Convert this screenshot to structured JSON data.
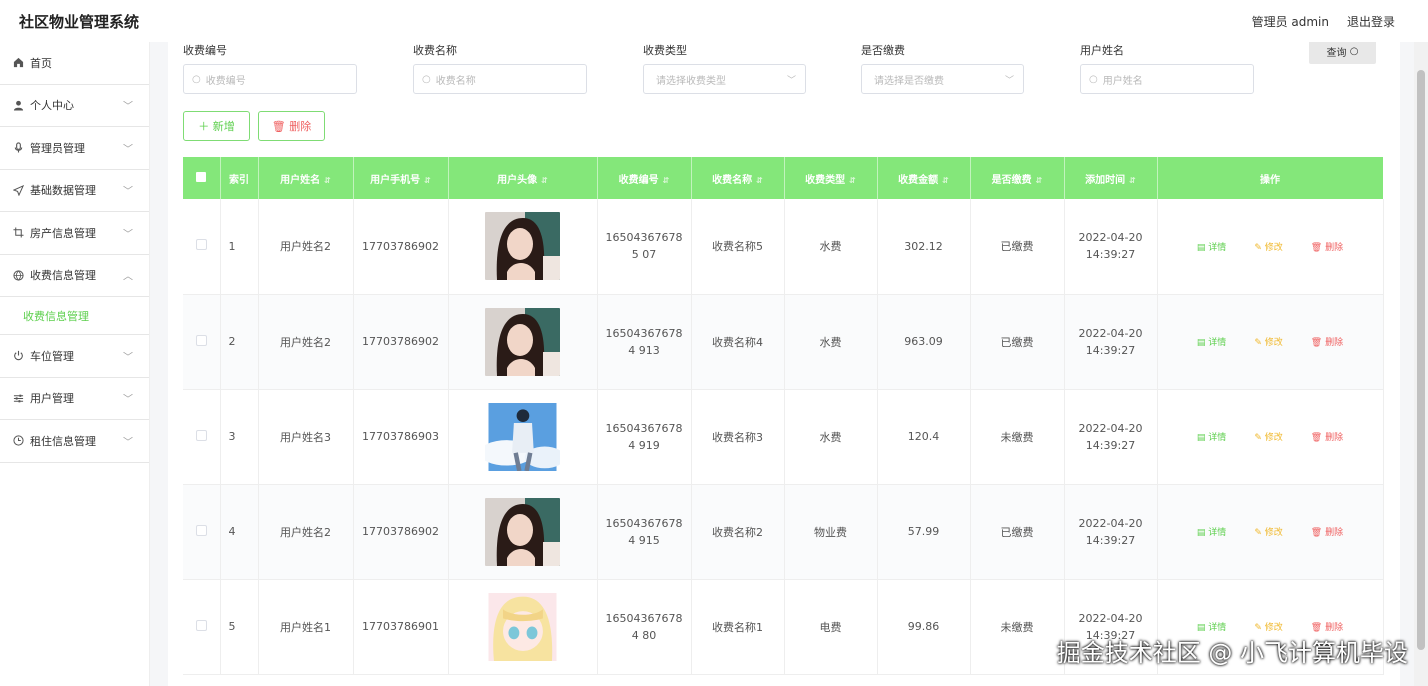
{
  "header": {
    "title": "社区物业管理系统",
    "user": "管理员 admin",
    "logout": "退出登录"
  },
  "sidebar": {
    "items": [
      {
        "label": "首页",
        "icon": "home-icon"
      },
      {
        "label": "个人中心",
        "icon": "user-icon"
      },
      {
        "label": "管理员管理",
        "icon": "mic-icon"
      },
      {
        "label": "基础数据管理",
        "icon": "send-icon"
      },
      {
        "label": "房产信息管理",
        "icon": "crop-icon"
      },
      {
        "label": "收费信息管理",
        "icon": "globe-icon"
      },
      {
        "label": "车位管理",
        "icon": "power-icon"
      },
      {
        "label": "用户管理",
        "icon": "sliders-icon"
      },
      {
        "label": "租住信息管理",
        "icon": "clock-icon"
      }
    ],
    "sub_item": "收费信息管理"
  },
  "search": {
    "fee_no": {
      "label": "收费编号",
      "placeholder": "收费编号"
    },
    "fee_name": {
      "label": "收费名称",
      "placeholder": "收费名称"
    },
    "fee_type": {
      "label": "收费类型",
      "placeholder": "请选择收费类型"
    },
    "paid": {
      "label": "是否缴费",
      "placeholder": "请选择是否缴费"
    },
    "user_name": {
      "label": "用户姓名",
      "placeholder": "用户姓名"
    },
    "query": "查询"
  },
  "toolbar": {
    "add": "＋ 新增",
    "delete": "删除"
  },
  "table": {
    "headers": [
      "索引",
      "用户姓名",
      "用户手机号",
      "用户头像",
      "收费编号",
      "收费名称",
      "收费类型",
      "收费金额",
      "是否缴费",
      "添加时间",
      "操作"
    ],
    "actions": {
      "detail": "详情",
      "edit": "修改",
      "delete": "删除"
    },
    "rows": [
      {
        "index": "1",
        "name": "用户姓名2",
        "phone": "17703786902",
        "no": "165043676785 07",
        "fee_name": "收费名称5",
        "type": "水费",
        "amount": "302.12",
        "paid": "已缴费",
        "time": "2022-04-20 14:39:27",
        "avatar": "girl"
      },
      {
        "index": "2",
        "name": "用户姓名2",
        "phone": "17703786902",
        "no": "165043676784 913",
        "fee_name": "收费名称4",
        "type": "水费",
        "amount": "963.09",
        "paid": "已缴费",
        "time": "2022-04-20 14:39:27",
        "avatar": "girl"
      },
      {
        "index": "3",
        "name": "用户姓名3",
        "phone": "17703786903",
        "no": "165043676784 919",
        "fee_name": "收费名称3",
        "type": "水费",
        "amount": "120.4",
        "paid": "未缴费",
        "time": "2022-04-20 14:39:27",
        "avatar": "boy"
      },
      {
        "index": "4",
        "name": "用户姓名2",
        "phone": "17703786902",
        "no": "165043676784 915",
        "fee_name": "收费名称2",
        "type": "物业费",
        "amount": "57.99",
        "paid": "已缴费",
        "time": "2022-04-20 14:39:27",
        "avatar": "girl"
      },
      {
        "index": "5",
        "name": "用户姓名1",
        "phone": "17703786901",
        "no": "165043676784 80",
        "fee_name": "收费名称1",
        "type": "电费",
        "amount": "99.86",
        "paid": "未缴费",
        "time": "2022-04-20 14:39:27",
        "avatar": "anime"
      }
    ]
  },
  "watermark": "掘金技术社区 @ 小飞计算机毕设",
  "colors": {
    "accent": "#5ccf4c",
    "header_green": "#84e77a",
    "danger": "#ef5f5f",
    "warn": "#f0b82c"
  }
}
